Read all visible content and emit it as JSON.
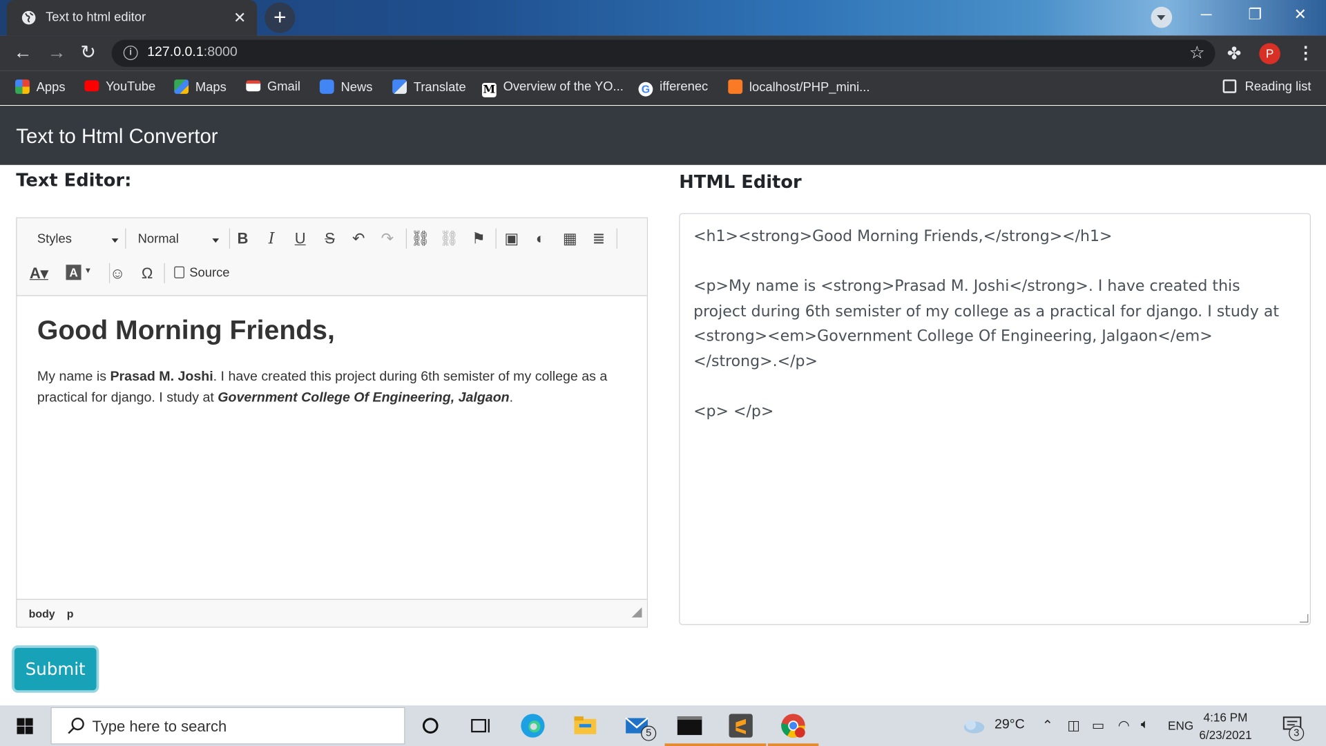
{
  "browser": {
    "tab_title": "Text to html editor",
    "url_host": "127.0.0.1",
    "url_port": ":8000",
    "profile_initial": "P",
    "bookmarks": [
      {
        "label": "Apps",
        "icon": "apps-grid-icon",
        "color": "#e94235"
      },
      {
        "label": "YouTube",
        "icon": "youtube-icon",
        "color": "#ff0000"
      },
      {
        "label": "Maps",
        "icon": "maps-icon",
        "color": "#34a853"
      },
      {
        "label": "Gmail",
        "icon": "gmail-icon",
        "color": "#ea4335"
      },
      {
        "label": "News",
        "icon": "news-icon",
        "color": "#4285f4"
      },
      {
        "label": "Translate",
        "icon": "translate-icon",
        "color": "#4285f4"
      },
      {
        "label": "Overview of the YO...",
        "icon": "medium-icon",
        "color": "#000000"
      },
      {
        "label": "ifferenec",
        "icon": "google-icon",
        "color": "#ffffff"
      },
      {
        "label": "localhost/PHP_mini...",
        "icon": "xampp-icon",
        "color": "#fb7a24"
      }
    ],
    "reading_list": "Reading list"
  },
  "page": {
    "brand": "Text to Html Convertor",
    "text_editor_heading": "Text Editor:",
    "html_editor_heading": "HTML Editor",
    "submit_label": "Submit"
  },
  "ckeditor": {
    "styles_combo": "Styles",
    "format_combo": "Normal",
    "toolbar_row1": [
      {
        "name": "bold-button",
        "glyph": "B"
      },
      {
        "name": "italic-button",
        "glyph": "I"
      },
      {
        "name": "underline-button",
        "glyph": "U"
      },
      {
        "name": "strikethrough-button",
        "glyph": "S"
      },
      {
        "name": "undo-button",
        "glyph": "↶"
      },
      {
        "name": "redo-button",
        "glyph": "↷"
      },
      {
        "name": "link-button",
        "glyph": "⛓"
      },
      {
        "name": "unlink-button",
        "glyph": "⛓"
      },
      {
        "name": "anchor-button",
        "glyph": "⚑"
      },
      {
        "name": "image-button",
        "glyph": "▣"
      },
      {
        "name": "flash-button",
        "glyph": "◐"
      },
      {
        "name": "table-button",
        "glyph": "▦"
      },
      {
        "name": "horizontal-rule-button",
        "glyph": "≣"
      }
    ],
    "source_label": "Source",
    "content_heading": "Good Morning Friends,",
    "p_before": "My name is ",
    "p_name": "Prasad M. Joshi",
    "p_middle": ". I have created this project during 6th semister of my college as a practical for django. I study at ",
    "p_college": "Government College Of Engineering, Jalgaon",
    "p_end": ".",
    "path_body": "body",
    "path_p": "p"
  },
  "html_editor": {
    "value": "<h1><strong>Good Morning Friends,</strong></h1>\n\n<p>My name is <strong>Prasad M. Joshi</strong>. I have created this project during 6th semister of my college as a practical for django. I study at <strong><em>Government College Of Engineering, Jalgaon</em></strong>.</p>\n\n<p> </p>"
  },
  "taskbar": {
    "search_placeholder": "Type here to search",
    "mail_badge": "5",
    "weather": "29°C",
    "language": "ENG",
    "time": "4:16 PM",
    "date": "6/23/2021",
    "notification_count": "3"
  }
}
